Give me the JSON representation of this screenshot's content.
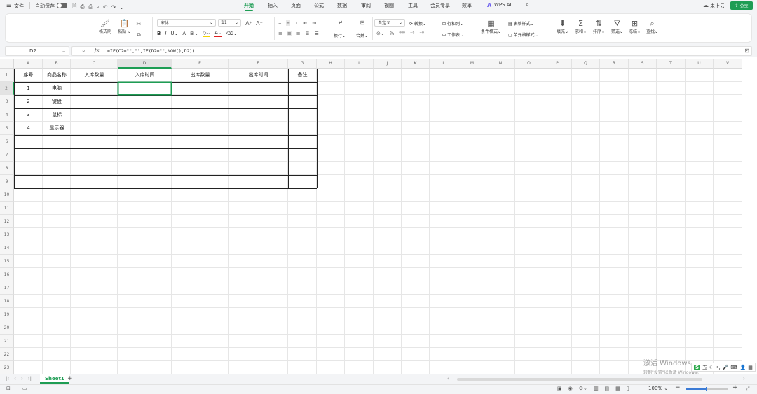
{
  "topbar": {
    "menu": "文件",
    "autosave": "自动保存",
    "tabs": [
      "开始",
      "插入",
      "页面",
      "公式",
      "数据",
      "审阅",
      "视图",
      "工具",
      "会员专享",
      "效率",
      "WPS AI"
    ],
    "cloud": "未上云",
    "share": "分享"
  },
  "ribbon": {
    "format_painter": "格式刷",
    "paste": "粘贴",
    "font_name": "宋体",
    "font_size": "11",
    "wrap": "换行",
    "merge": "合并",
    "num_format": "自定义",
    "convert": "转换",
    "rows_cols": "行和列",
    "worksheet": "工作表",
    "cond_format": "条件格式",
    "table_style": "表格样式",
    "cell_style": "单元格样式",
    "fill": "填充",
    "sum": "求和",
    "sort": "排序",
    "filter": "筛选",
    "freeze": "冻结",
    "find": "查找"
  },
  "formula": {
    "cell_ref": "D2",
    "fx": "fx",
    "text": "=IF(C2=\"\",\"\",IF(D2=\"\",NOW(),D2))"
  },
  "columns": [
    "A",
    "B",
    "C",
    "D",
    "E",
    "F",
    "G",
    "H",
    "I",
    "J",
    "K",
    "L",
    "M",
    "N",
    "O",
    "P",
    "Q",
    "R",
    "S",
    "T",
    "U",
    "V"
  ],
  "rows": [
    "1",
    "2",
    "3",
    "4",
    "5",
    "6",
    "7",
    "8",
    "9",
    "10",
    "11",
    "12",
    "13",
    "14",
    "15",
    "16",
    "17",
    "18",
    "19",
    "20",
    "21",
    "22",
    "23"
  ],
  "table": {
    "headers": [
      "序号",
      "商品名称",
      "入库数量",
      "入库时间",
      "出库数量",
      "出库时间",
      "备注"
    ],
    "data": [
      [
        "1",
        "电脑"
      ],
      [
        "2",
        "键盘"
      ],
      [
        "3",
        "鼠标"
      ],
      [
        "4",
        "显示器"
      ]
    ]
  },
  "sheet_tab": "Sheet1",
  "zoom": "100%",
  "watermark": {
    "line1": "激活 Windows",
    "line2": "转到\"设置\"以激活 Windows。"
  },
  "ime": "五"
}
